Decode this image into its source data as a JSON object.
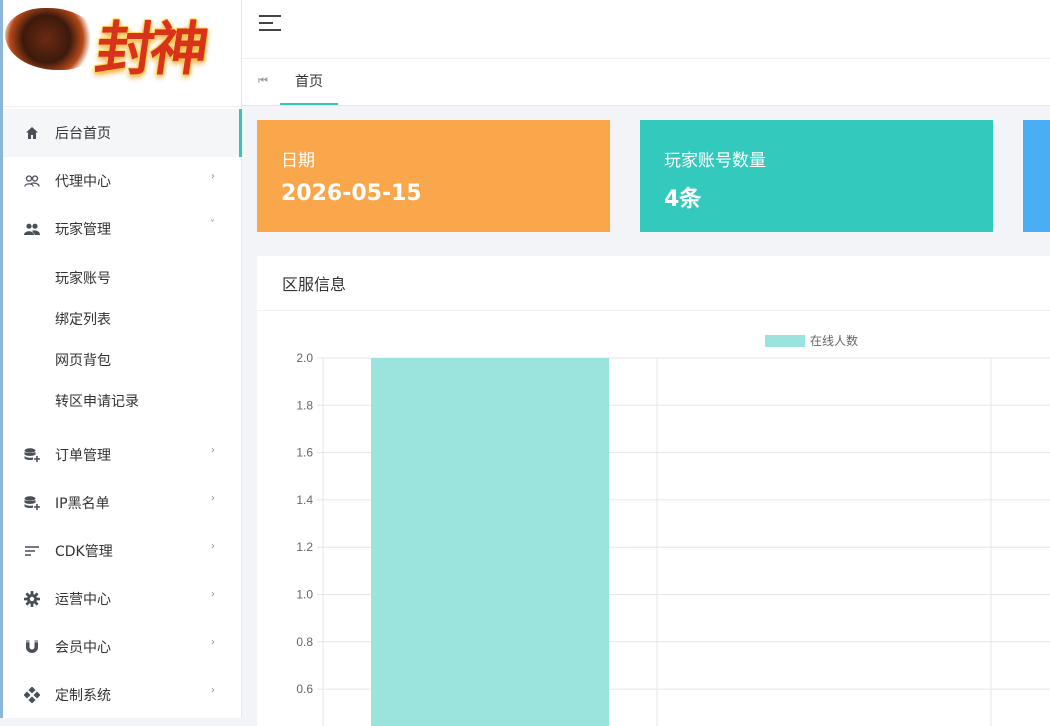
{
  "brand": {
    "logo_text": "封神"
  },
  "sidebar": {
    "items": [
      {
        "label": "后台首页",
        "icon": "home-icon",
        "active": true
      },
      {
        "label": "代理中心",
        "icon": "users-outline-icon",
        "arrow": "›"
      },
      {
        "label": "玩家管理",
        "icon": "users-icon",
        "arrow": "˅",
        "children": [
          "玩家账号",
          "绑定列表",
          "网页背包",
          "转区申请记录"
        ]
      },
      {
        "label": "订单管理",
        "icon": "database-add-icon",
        "arrow": "›"
      },
      {
        "label": "IP黑名单",
        "icon": "database-add-icon",
        "arrow": "›"
      },
      {
        "label": "CDK管理",
        "icon": "sort-lines-icon",
        "arrow": "›"
      },
      {
        "label": "运营中心",
        "icon": "gear-icon",
        "arrow": "›"
      },
      {
        "label": "会员中心",
        "icon": "magnet-icon",
        "arrow": "›"
      },
      {
        "label": "定制系统",
        "icon": "diamond-grid-icon",
        "arrow": "›"
      }
    ]
  },
  "tabs": {
    "prev_icon": "⏮",
    "items": [
      "首页"
    ]
  },
  "cards": {
    "date": {
      "label": "日期",
      "value": "2026-05-15"
    },
    "players": {
      "label": "玩家账号数量",
      "value": "4条"
    }
  },
  "panel": {
    "title": "区服信息"
  },
  "colors": {
    "accent": "#32c5b8",
    "card_orange": "#faa64b",
    "card_teal": "#34c9bd",
    "card_blue": "#4aaef2",
    "bar": "#9ae4dd"
  },
  "chart_data": {
    "type": "bar",
    "series": [
      {
        "name": "在线人数",
        "values": [
          2,
          0,
          0
        ]
      }
    ],
    "categories": [
      "",
      "",
      ""
    ],
    "ylim_visible": [
      0.6,
      2.0
    ],
    "yticks": [
      "2.0",
      "1.8",
      "1.6",
      "1.4",
      "1.2",
      "1.0",
      "0.8",
      "0.6"
    ],
    "legend": "top-center",
    "grid": true
  }
}
